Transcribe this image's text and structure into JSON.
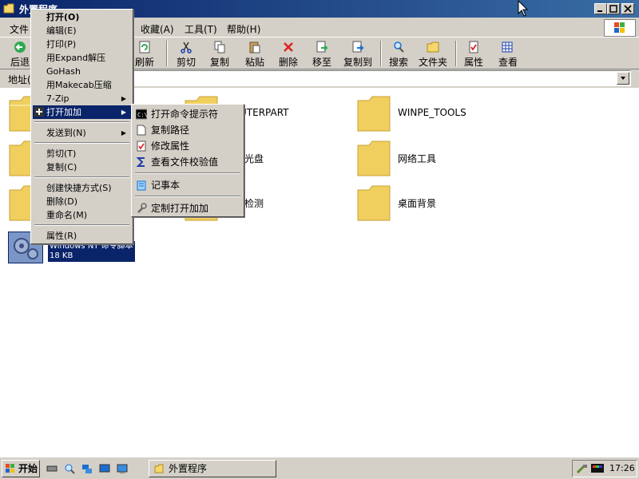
{
  "window": {
    "title": "外置程序"
  },
  "menubar": [
    "文件",
    "收藏(A)",
    "工具(T)",
    "帮助(H)"
  ],
  "toolbar": [
    "后退",
    "刷新",
    "剪切",
    "复制",
    "粘贴",
    "删除",
    "移至",
    "复制到",
    "搜索",
    "文件夹",
    "属性",
    "查看"
  ],
  "address": {
    "label": "地址("
  },
  "items": [
    {
      "name": "UTERPART"
    },
    {
      "name": "WINPE_TOOLS"
    },
    {
      "name": "光盘"
    },
    {
      "name": "网络工具"
    },
    {
      "name": "检测"
    },
    {
      "name": "桌面背景"
    }
  ],
  "selected": {
    "name": "Windows NT 命令脚本",
    "size": "18 KB"
  },
  "context_menu": [
    "打开(O)",
    "编辑(E)",
    "打印(P)",
    "用Expand解压",
    "GoHash",
    "用Makecab压缩",
    "7-Zip",
    "打开加加",
    "发送到(N)",
    "剪切(T)",
    "复制(C)",
    "创建快捷方式(S)",
    "删除(D)",
    "重命名(M)",
    "属性(R)"
  ],
  "submenu": [
    "打开命令提示符",
    "复制路径",
    "修改属性",
    "查看文件校验值",
    "记事本",
    "定制打开加加"
  ],
  "taskbar": {
    "start": "开始",
    "task": "外置程序",
    "clock": "17:26"
  }
}
